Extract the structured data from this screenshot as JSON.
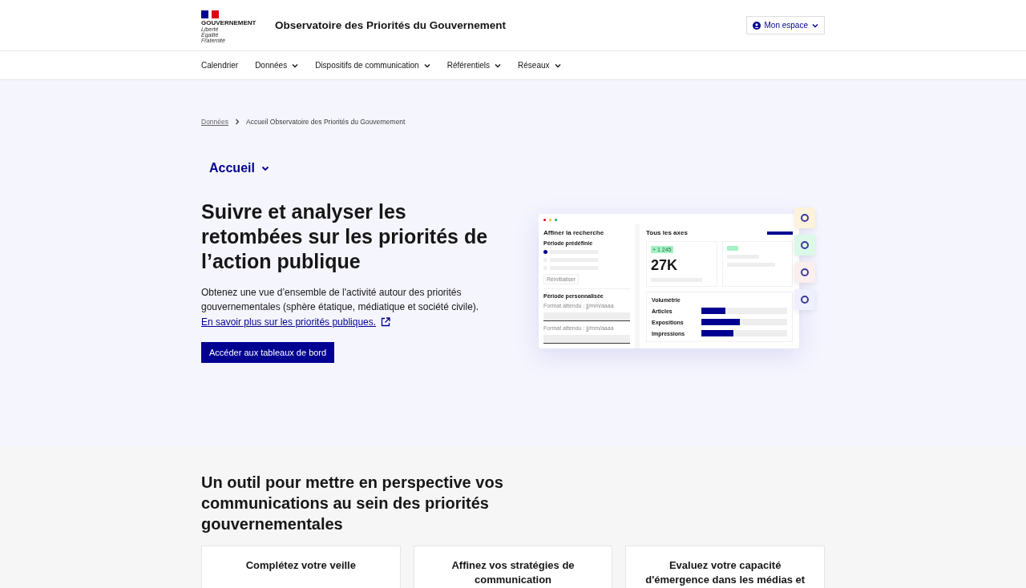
{
  "header": {
    "logo_text": "GOUVERNEMENT",
    "motto": [
      "Liberté",
      "Égalité",
      "Fraternité"
    ],
    "site_title": "Observatoire des Priorités du Gouvernement",
    "account_button": "Mon espace"
  },
  "nav": [
    {
      "label": "Calendrier",
      "dropdown": false
    },
    {
      "label": "Données",
      "dropdown": true
    },
    {
      "label": "Dispositifs de communication",
      "dropdown": true
    },
    {
      "label": "Référentiels",
      "dropdown": true
    },
    {
      "label": "Réseaux",
      "dropdown": true
    }
  ],
  "breadcrumb": [
    {
      "label": "Données",
      "current": false
    },
    {
      "label": "Accueil Observatoire des Priorités du Gouvernement",
      "current": true
    }
  ],
  "section_menu": {
    "label": "Accueil"
  },
  "hero": {
    "title": "Suivre et analyser les retombées sur les priorités de l’action publique",
    "text": "Obtenez une vue d’ensemble de l'activité autour des priorités gouvernementales (sphère étatique, médiatique et société civile).",
    "link": "En savoir plus sur les priorités publiques.",
    "button": "Accéder aux tableaux de bord"
  },
  "illustration": {
    "panel_title": "Affiner la recherche",
    "preset_label": "Période prédéfinie",
    "options": [
      {
        "selected": true
      },
      {
        "selected": false
      },
      {
        "selected": false
      }
    ],
    "reset": "Réinitialiser",
    "custom_label": "Période personnalisée",
    "hints": [
      "Format attendu : jj/mm/aaaa",
      "Format attendu : jj/mm/aaaa"
    ],
    "main_title": "Tous les axes",
    "badge": "+ 1 245",
    "kpi": "27K",
    "chart_title": "Volumétrie",
    "bars": [
      {
        "label": "Articles",
        "level": 0.28
      },
      {
        "label": "Expositions",
        "level": 0.45
      },
      {
        "label": "Impressions",
        "level": 0.37
      }
    ]
  },
  "features": {
    "title": "Un outil pour mettre en perspective vos communications au sein des priorités gouvernementales",
    "cards": [
      "Complétez votre veille",
      "Affinez vos stratégies de communication",
      "Evaluez votre capacité d'émergence dans les médias et"
    ]
  }
}
